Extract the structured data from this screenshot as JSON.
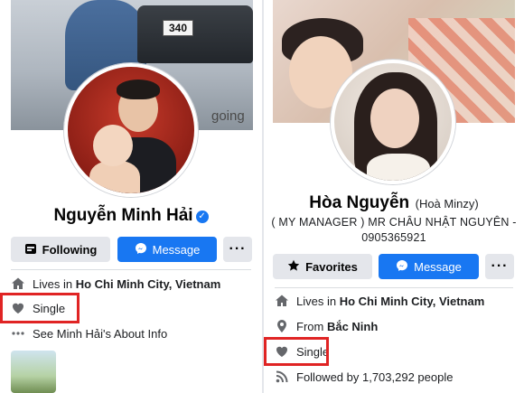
{
  "left": {
    "cover_plate": "340",
    "cover_word": "going",
    "name": "Nguyễn Minh Hải",
    "verified_mark": "✓",
    "buttons": {
      "following": "Following",
      "message": "Message",
      "more": "···"
    },
    "info": {
      "lives_prefix": "Lives in ",
      "lives_city": "Ho Chi Minh City, Vietnam",
      "relationship": "Single",
      "about": "See Minh Hải's About Info"
    }
  },
  "right": {
    "name": "Hòa Nguyễn",
    "alt_name": "(Hoà Minzy)",
    "bio_line1": "( MY MANAGER ) MR CHÂU NHẬT NGUYÊN -",
    "bio_line2": "0905365921",
    "buttons": {
      "favorites": "Favorites",
      "message": "Message",
      "more": "···"
    },
    "info": {
      "lives_prefix": "Lives in ",
      "lives_city": "Ho Chi Minh City, Vietnam",
      "from_prefix": "From ",
      "from_place": "Bắc Ninh",
      "relationship": "Single",
      "followers": "Followed by 1,703,292 people"
    }
  },
  "colors": {
    "fb_blue": "#1877f2",
    "highlight_red": "#e02424",
    "button_grey": "#e4e6eb"
  },
  "icons": [
    "messenger-icon",
    "following-icon",
    "star-icon",
    "home-icon",
    "location-pin-icon",
    "heart-icon",
    "more-dots-icon",
    "rss-icon",
    "verified-badge-icon"
  ]
}
